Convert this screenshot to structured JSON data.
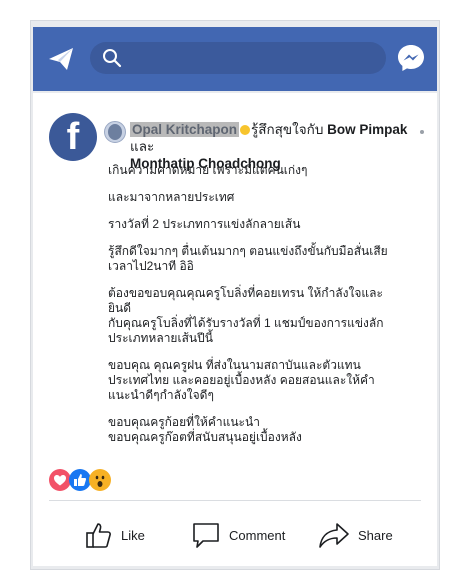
{
  "topbar": {
    "search": {
      "placeholder": ""
    },
    "colors": {
      "bar": "#4267b2",
      "search": "#3b5a9c"
    }
  },
  "post": {
    "page_logo": "f",
    "author": "Opal Kritchapon",
    "feeling": "รู้สึกสุขใจกับ",
    "tagged_1": "Bow Pimpak",
    "conjunction": "และ",
    "tagged_2": "Monthatip Choadchong",
    "paragraphs": [
      "เกินความคาดหมาย เพราะมีแต่คนเก่งๆ",
      "และมาจากหลายประเทศ",
      "รางวัลที่ 2 ประเภทการแข่งลักลายเส้น",
      "รู้สึกดีใจมากๆ ตื่นเต้นมากๆ ตอนแข่งถึงขั้นกับมือสั่นเสีย\nเวลาไป2นาที อิอิ",
      "ต้องขอขอบคุณคุณครูโบลิ่งที่คอยเทรน ให้กำลังใจและยินดี\nกับคุณครูโบลิ่งที่ได้รับรางวัลที่ 1 แชมป์ของการแข่งลัก\nประเภทหลายเส้นปีนี้",
      "ขอบคุณ คุณครูฝน ที่ส่งในนามสถาบันและตัวแทน\nประเทศไทย และคอยอยู่เบื้องหลัง คอยสอนและให้คำ\nแนะนำดีๆกำลังใจดีๆ",
      "ขอบคุณครูก้อยที่ให้คำแนะนำ\nขอบคุณครูก๊อตที่สนับสนุนอยู่เบื้องหลัง"
    ],
    "reactions": [
      "love-reaction",
      "like-reaction",
      "wow-reaction"
    ]
  },
  "actions": {
    "like_label": "Like",
    "comment_label": "Comment",
    "share_label": "Share"
  }
}
